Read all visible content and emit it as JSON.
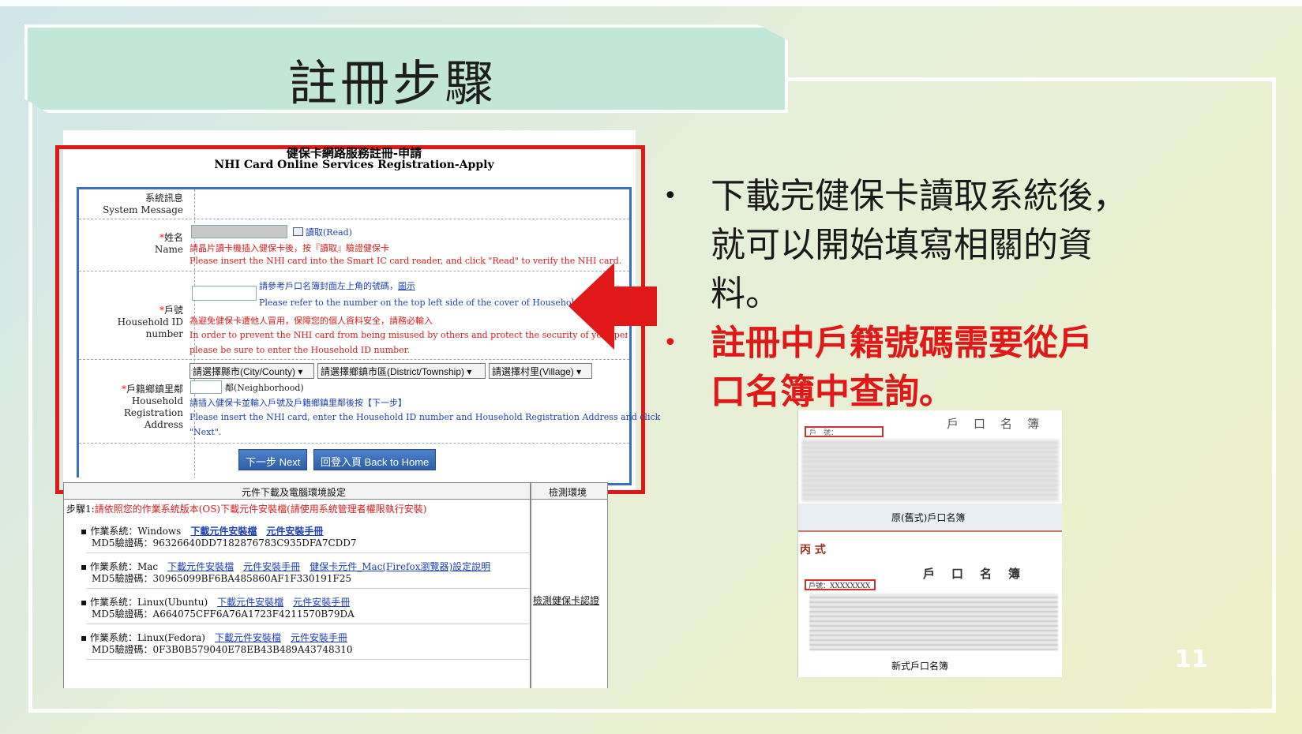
{
  "slide": {
    "title": "註冊步驟",
    "page_number": "11"
  },
  "form": {
    "title_zh": "健保卡網路服務註冊-申請",
    "title_en": "NHI Card Online Services Registration-Apply",
    "system_message_zh": "系統訊息",
    "system_message_en": "System Message",
    "name_req": "*",
    "name_zh": "姓名",
    "name_en": "Name",
    "read_button": "讀取(Read)",
    "name_hint_zh": "請晶片讀卡機插入健保卡後，按『讀取』驗證健保卡",
    "name_hint_en": "Please insert the NHI card into the Smart IC card reader, and click \"Read\" to verify the NHI card.",
    "hh_req": "*",
    "hh_zh": "戶號",
    "hh_en": "Household ID number",
    "hh_ref_zh": "請參考戶口名簿封面左上角的號碼，",
    "hh_ref_link": "圖示",
    "hh_ref_en": "Please refer to the number on the top left side of the cover of Household Certificate.",
    "hh_warn_zh": "為避免健保卡遭他人冒用，保障您的個人資料安全，請務必輸入",
    "hh_warn_en": "In order to prevent the NHI card from being misused by others and protect the security of your personal da",
    "hh_warn_en2": "please be sure to enter the Household ID number.",
    "addr_req": "*",
    "addr_zh": "戶籍鄉鎮里鄰",
    "addr_en1": "Household Registration",
    "addr_en2": "Address",
    "city_select": "請選擇縣市(City/County)",
    "district_select": "請選擇鄉鎮市區(District/Township)",
    "village_select": "請選擇村里(Village)",
    "neighborhood_label": "鄰(Neighborhood)",
    "addr_hint_zh": "請插入健保卡並輸入戶號及戶籍鄉鎮里鄰後按【下一步】",
    "addr_hint_en": "Please insert the NHI card, enter the Household ID number and Household Registration Address and click",
    "addr_hint_en2": "\"Next\".",
    "next_button": "下一步 Next",
    "home_button": "回登入頁 Back to Home"
  },
  "lower": {
    "header": "元件下載及電腦環境設定",
    "header_right": "檢測環境",
    "step_prefix": "步驟1:",
    "step_text": "請依照您的作業系統版本(OS)下載元件安裝檔(請使用系統管理者權限執行安裝)",
    "check_link": "檢測健保卡認證",
    "items": [
      {
        "os": "作業系統：Windows",
        "links": [
          "下載元件安裝檔",
          "元件安裝手冊"
        ],
        "md5": "MD5驗證碼：96326640DD7182876783C935DFA7CDD7"
      },
      {
        "os": "作業系統：Mac",
        "links": [
          "下載元件安裝檔",
          "元件安裝手冊",
          "健保卡元件_Mac(Firefox瀏覽器)設定說明"
        ],
        "md5": "MD5驗證碼：30965099BF6BA485860AF1F330191F25"
      },
      {
        "os": "作業系統：Linux(Ubuntu)",
        "links": [
          "下載元件安裝檔",
          "元件安裝手冊"
        ],
        "md5": "MD5驗證碼：A664075CFF6A76A1723F4211570B79DA"
      },
      {
        "os": "作業系統：Linux(Fedora)",
        "links": [
          "下載元件安裝檔",
          "元件安裝手冊"
        ],
        "md5": "MD5驗證碼：0F3B0B579040E78EB43B489A43748310"
      }
    ]
  },
  "bullets": {
    "b1_l1": "下載完健保卡讀取系統後，",
    "b1_l2": "就可以開始填寫相關的資",
    "b1_l3": "料。",
    "b2_l1": "註冊中戶籍號碼需要從戶",
    "b2_l2": "口名簿中查詢。",
    "bullet_char": "•"
  },
  "household_image": {
    "old_header": "戶　口　名　簿",
    "old_hh_label": "戶　號：",
    "old_caption": "原(舊式)戶口名簿",
    "new_prefix": "丙 式",
    "new_header": "戶　口　名　簿",
    "new_hh_label": "戶號：XXXXXXXX",
    "new_caption": "新式戶口名簿"
  },
  "colors": {
    "accent_red": "#e01818",
    "link_blue": "#1f3fb5",
    "title_bg": "#c2e6d7"
  }
}
